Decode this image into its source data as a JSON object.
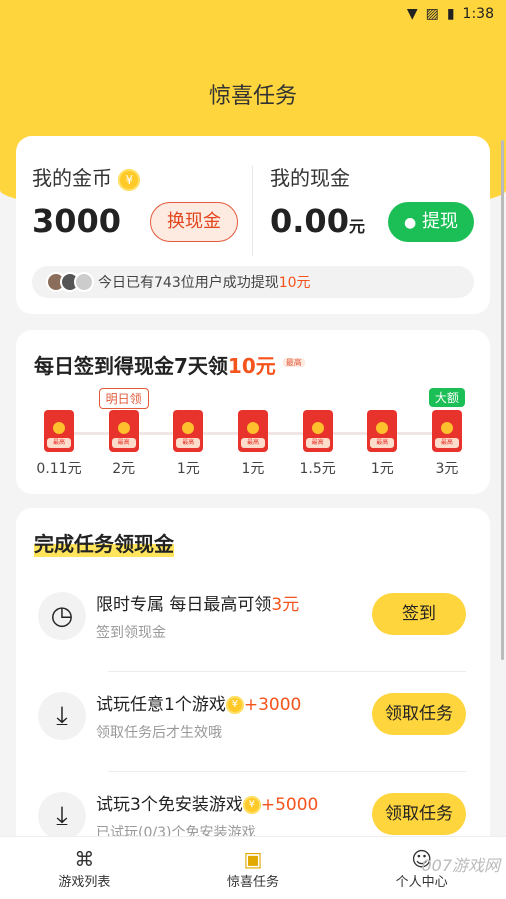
{
  "status": {
    "time": "1:38"
  },
  "header": {
    "title": "惊喜任务"
  },
  "wallet": {
    "coins_label": "我的金币",
    "coins_value": "3000",
    "exchange_label": "换现金",
    "cash_label": "我的现金",
    "cash_value": "0.00",
    "cash_unit": "元",
    "withdraw_label": "提现",
    "ticker_prefix": "今日已有743位用户成功提现",
    "ticker_amount": "10元"
  },
  "checkin": {
    "title_prefix": "每日签到得现金7天领",
    "title_amount": "10元",
    "title_badge": "最高",
    "envelope_label": "最高",
    "days": [
      {
        "amount": "0.11元",
        "tag": ""
      },
      {
        "amount": "2元",
        "tag": "明日领"
      },
      {
        "amount": "1元",
        "tag": ""
      },
      {
        "amount": "1元",
        "tag": ""
      },
      {
        "amount": "1.5元",
        "tag": ""
      },
      {
        "amount": "1元",
        "tag": ""
      },
      {
        "amount": "3元",
        "tag": "大额"
      }
    ]
  },
  "tasks": {
    "section_title": "完成任务领现金",
    "items": [
      {
        "title": "限时专属 每日最高可领",
        "reward": "3元",
        "subtitle": "签到领现金",
        "button": "签到",
        "icon": "clock-icon"
      },
      {
        "title": "试玩任意1个游戏",
        "reward": "+3000",
        "subtitle": "领取任务后才生效哦",
        "button": "领取任务",
        "icon": "download-icon"
      },
      {
        "title": "试玩3个免安装游戏",
        "reward": "+5000",
        "subtitle": "已试玩(0/3)个免安装游戏",
        "button": "领取任务",
        "icon": "download-icon"
      }
    ]
  },
  "tabbar": {
    "items": [
      {
        "label": "游戏列表",
        "icon": "gamepad-icon"
      },
      {
        "label": "惊喜任务",
        "icon": "tv-gift-icon"
      },
      {
        "label": "个人中心",
        "icon": "person-icon"
      }
    ]
  },
  "watermark": "007游戏网",
  "colors": {
    "accent": "#ffd53d",
    "red": "#e8332c",
    "green": "#1bbf55",
    "orange": "#f5531c"
  }
}
